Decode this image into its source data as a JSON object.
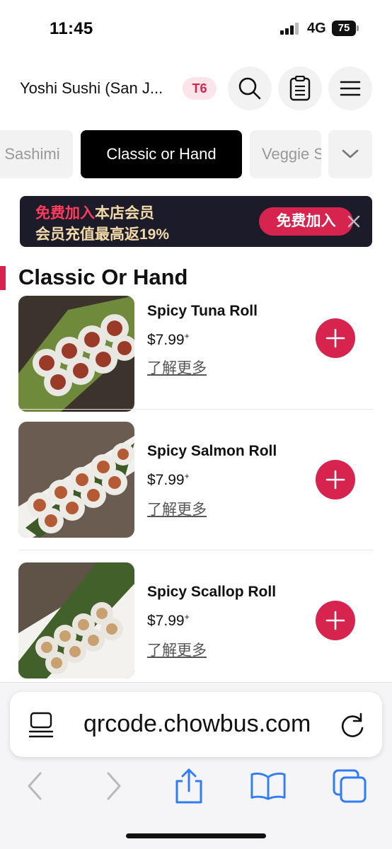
{
  "status_bar": {
    "time": "11:45",
    "network": "4G",
    "battery": "75"
  },
  "header": {
    "store_name": "Yoshi Sushi (San J...",
    "table_badge": "T6"
  },
  "tabs": [
    {
      "label": "Sashimi",
      "active": false
    },
    {
      "label": "Classic or Hand",
      "active": true
    },
    {
      "label": "Veggie S",
      "active": false
    }
  ],
  "banner": {
    "line1_highlight": "免费加入",
    "line1_rest": "本店会员",
    "line2": "会员充值最高返19%",
    "join_label": "免费加入"
  },
  "section": {
    "title": "Classic Or Hand"
  },
  "menu_items": [
    {
      "name": "Spicy Tuna Roll",
      "price": "$7.99",
      "price_mark": "+",
      "more": "了解更多"
    },
    {
      "name": "Spicy Salmon Roll",
      "price": "$7.99",
      "price_mark": "+",
      "more": "了解更多"
    },
    {
      "name": "Spicy Scallop Roll",
      "price": "$7.99",
      "price_mark": "+",
      "more": "了解更多"
    }
  ],
  "browser": {
    "url": "qrcode.chowbus.com"
  },
  "colors": {
    "accent": "#d6244e",
    "ios_blue": "#2f7cf6",
    "banner_bg": "#1b1b2a",
    "banner_text": "#f3d9a8"
  },
  "icons": {
    "header": [
      "search-icon",
      "order-list-icon",
      "menu-icon"
    ],
    "tabs_more": "chevron-down-icon",
    "banner_close": "close-icon",
    "item_add": "plus-icon",
    "browser": [
      "page-menu-icon",
      "reload-icon",
      "back-icon",
      "forward-icon",
      "share-icon",
      "bookmarks-icon",
      "tabs-icon"
    ]
  }
}
